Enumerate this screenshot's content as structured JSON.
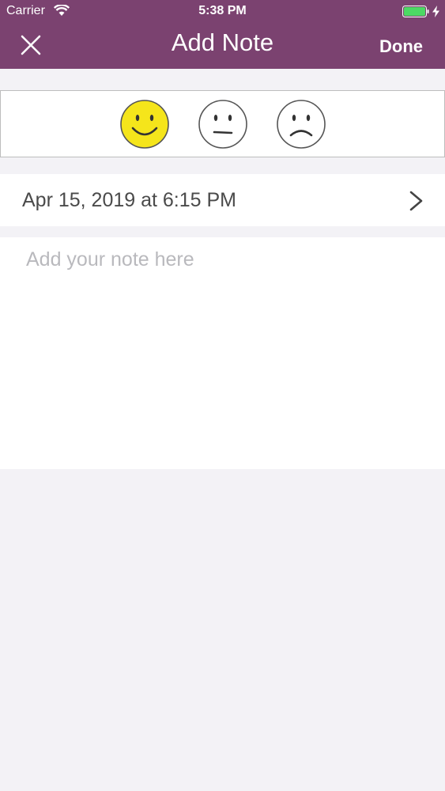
{
  "status_bar": {
    "carrier": "Carrier",
    "time": "5:38 PM"
  },
  "header": {
    "title": "Add Note",
    "done_label": "Done"
  },
  "moods": [
    {
      "name": "happy",
      "selected": true,
      "fill": "#f5e51b"
    },
    {
      "name": "neutral",
      "selected": false
    },
    {
      "name": "sad",
      "selected": false
    }
  ],
  "entry": {
    "date": "Apr 15, 2019 at 6:15 PM"
  },
  "note": {
    "placeholder": "Add your note here",
    "value": ""
  },
  "colors": {
    "header": "#7b4270",
    "background": "#f3f2f6",
    "battery": "#4cd964"
  }
}
